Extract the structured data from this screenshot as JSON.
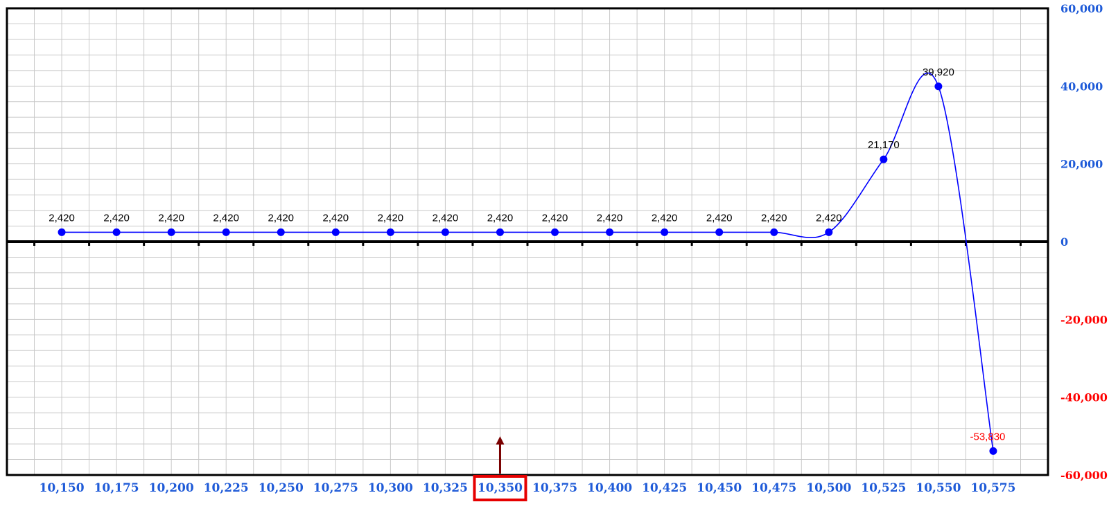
{
  "chart_data": {
    "type": "line",
    "x": [
      10150,
      10175,
      10200,
      10225,
      10250,
      10275,
      10300,
      10325,
      10350,
      10375,
      10400,
      10425,
      10450,
      10475,
      10500,
      10525,
      10550,
      10575
    ],
    "x_labels": [
      "10,150",
      "10,175",
      "10,200",
      "10,225",
      "10,250",
      "10,275",
      "10,300",
      "10,325",
      "10,350",
      "10,375",
      "10,400",
      "10,425",
      "10,450",
      "10,475",
      "10,500",
      "10,525",
      "10,550",
      "10,575"
    ],
    "values": [
      2420,
      2420,
      2420,
      2420,
      2420,
      2420,
      2420,
      2420,
      2420,
      2420,
      2420,
      2420,
      2420,
      2420,
      2420,
      21170,
      39920,
      -53830
    ],
    "data_labels": [
      "2,420",
      "2,420",
      "2,420",
      "2,420",
      "2,420",
      "2,420",
      "2,420",
      "2,420",
      "2,420",
      "2,420",
      "2,420",
      "2,420",
      "2,420",
      "2,420",
      "2,420",
      "21,170",
      "39,920",
      "-53,830"
    ],
    "y_ticks": [
      60000,
      40000,
      20000,
      0,
      -20000,
      -40000,
      -60000
    ],
    "y_tick_labels": [
      "60,000",
      "40,000",
      "20,000",
      "0",
      "-20,000",
      "-40,000",
      "-60,000"
    ],
    "ylim": [
      -60000,
      60000
    ],
    "xlim": [
      10125,
      10600
    ],
    "y_axis_side": "right",
    "grid": true,
    "highlight_x": 10350,
    "marker": "arrow-up",
    "colors": {
      "series": "#0000ff",
      "positive_tick": "#1f5bd8",
      "negative_tick": "#ff0000",
      "x_tick": "#1f5bd8",
      "highlight": "#e60000",
      "arrow": "#7a0000",
      "grid": "#c8c8c8",
      "label_positive": "#000000",
      "label_negative": "#ff0000"
    }
  }
}
